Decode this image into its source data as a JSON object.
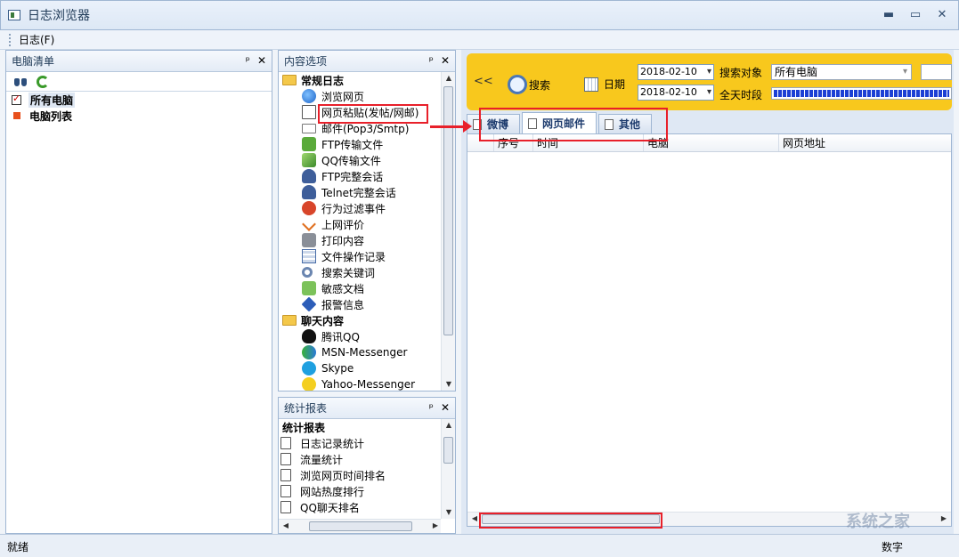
{
  "window": {
    "title": "日志浏览器"
  },
  "menu": {
    "items": [
      "日志(F)"
    ]
  },
  "computer_panel": {
    "title": "电脑清单",
    "items": [
      {
        "label": "所有电脑",
        "checked": true
      },
      {
        "label": "电脑列表"
      }
    ]
  },
  "content_panel": {
    "title": "内容选项",
    "categories": [
      {
        "label": "常规日志",
        "items": [
          "浏览网页",
          "网页粘贴(发帖/网邮)",
          "邮件(Pop3/Smtp)",
          "FTP传输文件",
          "QQ传输文件",
          "FTP完整会话",
          "Telnet完整会话",
          "行为过滤事件",
          "上网评价",
          "打印内容",
          "文件操作记录",
          "搜索关键词",
          "敏感文档",
          "报警信息"
        ]
      },
      {
        "label": "聊天内容",
        "items": [
          "腾讯QQ",
          "MSN-Messenger",
          "Skype",
          "Yahoo-Messenger"
        ]
      }
    ]
  },
  "report_panel": {
    "title": "统计报表",
    "heading": "统计报表",
    "items": [
      "日志记录统计",
      "流量统计",
      "浏览网页时间排名",
      "网站热度排行",
      "QQ聊天排名"
    ]
  },
  "search": {
    "collapse": "<<",
    "search_label": "搜索",
    "date_label": "日期",
    "date_from": "2018-02-10",
    "date_to": "2018-02-10",
    "target_label": "搜索对象",
    "target_value": "所有电脑",
    "time_label": "全天时段"
  },
  "tabs": [
    "微博",
    "网页邮件",
    "其他"
  ],
  "grid": {
    "columns": [
      "序号",
      "时间",
      "电脑",
      "网页地址"
    ]
  },
  "status": {
    "left": "就绪",
    "right": "数字"
  },
  "watermark": "系统之家",
  "colors": {
    "accent_bar": "#f8c81d",
    "highlight": "#e8202a"
  }
}
